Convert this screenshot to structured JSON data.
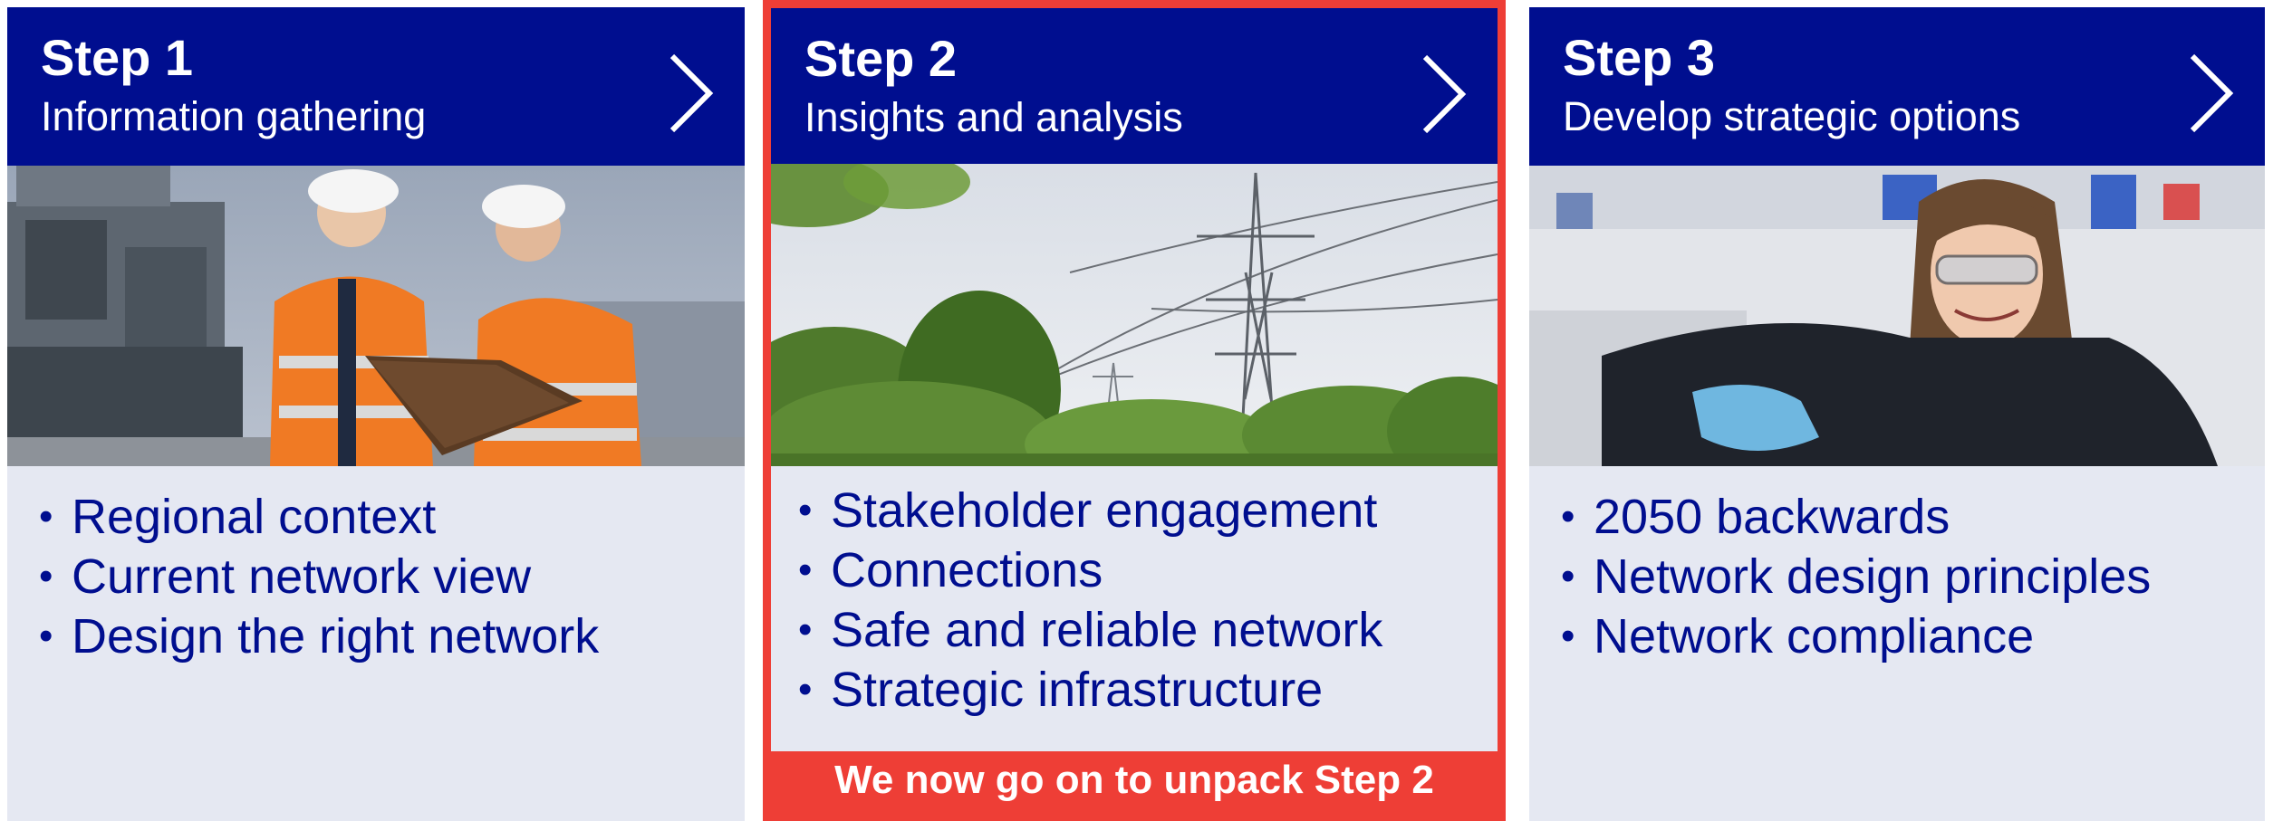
{
  "colors": {
    "header_blue": "#000e8f",
    "panel_bg": "#e5e8f2",
    "highlight_red": "#ee3e36",
    "text_blue": "#000e8f"
  },
  "steps": [
    {
      "title": "Step 1",
      "subtitle": "Information gathering",
      "image": "two-engineers-with-clipboard-photo",
      "bullets": [
        "Regional context",
        "Current network view",
        "Design the right network"
      ]
    },
    {
      "title": "Step 2",
      "subtitle": "Insights and analysis",
      "image": "electricity-pylons-and-trees-photo",
      "bullets": [
        "Stakeholder engagement",
        "Connections",
        "Safe and reliable network",
        "Strategic infrastructure"
      ]
    },
    {
      "title": "Step 3",
      "subtitle": "Develop strategic options",
      "image": "smiling-technician-with-safety-glasses-photo",
      "bullets": [
        "2050 backwards",
        "Network design principles",
        "Network compliance"
      ]
    }
  ],
  "banner": {
    "text": "We now go on to unpack Step 2"
  },
  "icons": {
    "next": "chevron-right-icon"
  }
}
